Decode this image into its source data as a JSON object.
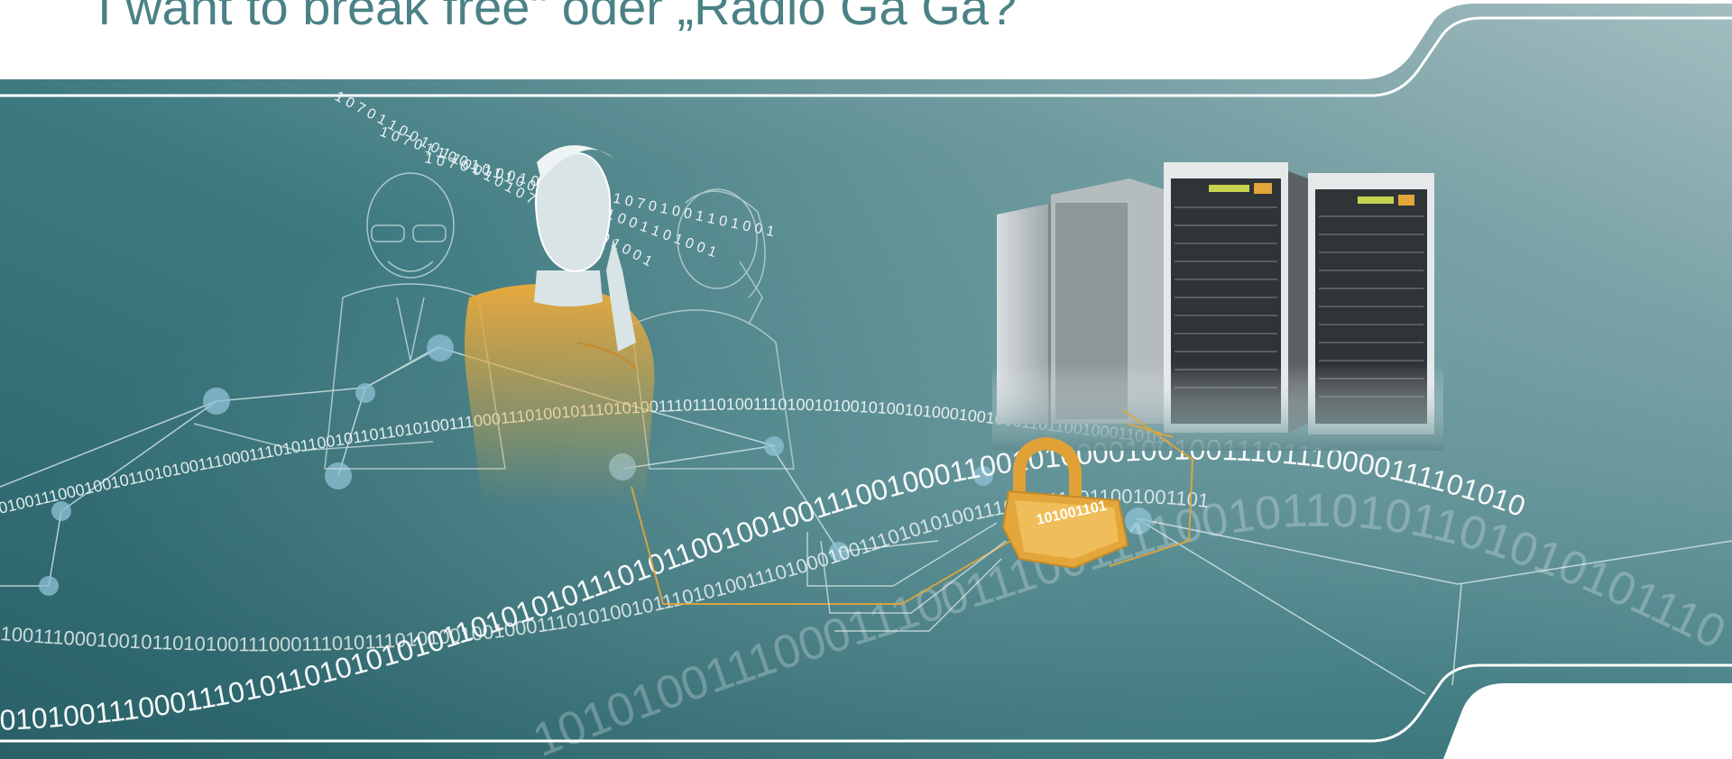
{
  "slide": {
    "title": "I want to break free\" oder „Radio Ga Ga?",
    "lock_label": "101001101",
    "binary_streams": [
      "0100111000100101101010011100011101011001011011010100111000111010010111010100111011101001110100101001010010100010010001101100100011010",
      "100111000100101101010011100011101011101010010010001110101001011101010011101000100111010101001110100111011001001101",
      "0101001110001110101101010101011010101011101011001001001110010001100101000010010011101110000111101010",
      "10101001110001110011100111100101101011010101011100101001001000110101011100100100011100101001001010011010"
    ],
    "falling_digits": "1 0 7 0 1 1 0 0 1 0 1 1 0 0 1 0 1 0 7 0 1 0 0 1 1 0 1 0 0 1"
  },
  "colors": {
    "title": "#4a8186",
    "banner_dark": "#2f6b72",
    "banner_light": "#9ab6b9",
    "accent_orange": "#e3a63a",
    "line_white": "#ffffff",
    "node_blue": "#8fc3d6"
  },
  "icons": [
    "padlock-icon",
    "server-rack-icon",
    "circuit-trace-icon"
  ]
}
